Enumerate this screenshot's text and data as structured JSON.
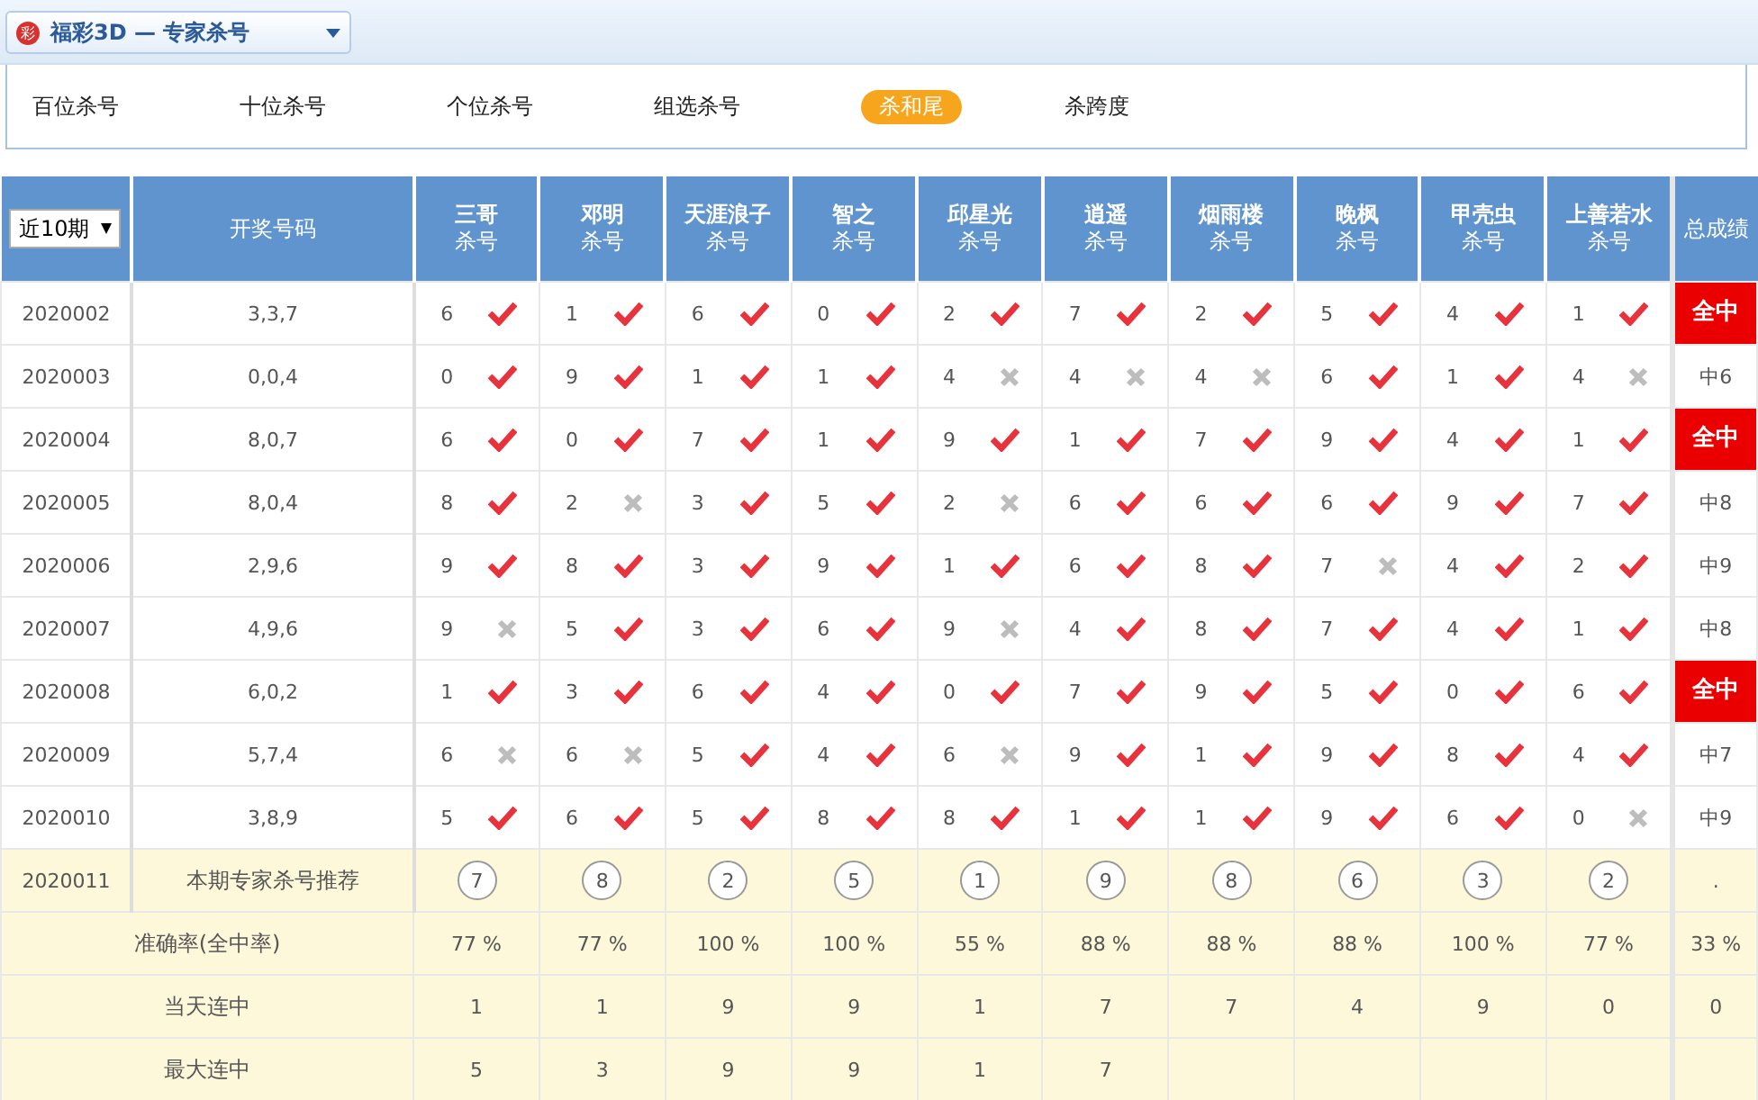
{
  "header": {
    "logo": "彩",
    "product": "福彩3D",
    "separator": "—",
    "title": "专家杀号"
  },
  "tabs": [
    {
      "label": "百位杀号",
      "selected": false
    },
    {
      "label": "十位杀号",
      "selected": false
    },
    {
      "label": "个位杀号",
      "selected": false
    },
    {
      "label": "组选杀号",
      "selected": false
    },
    {
      "label": "杀和尾",
      "selected": true
    },
    {
      "label": "杀跨度",
      "selected": false
    }
  ],
  "table": {
    "period_select": "近10期",
    "draw_heading": "开奖号码",
    "total_heading": "总成绩",
    "experts": [
      {
        "name": "三哥",
        "sub": "杀号"
      },
      {
        "name": "邓明",
        "sub": "杀号"
      },
      {
        "name": "天涯浪子",
        "sub": "杀号"
      },
      {
        "name": "智之",
        "sub": "杀号"
      },
      {
        "name": "邱星光",
        "sub": "杀号"
      },
      {
        "name": "逍遥",
        "sub": "杀号"
      },
      {
        "name": "烟雨楼",
        "sub": "杀号"
      },
      {
        "name": "晚枫",
        "sub": "杀号"
      },
      {
        "name": "甲壳虫",
        "sub": "杀号"
      },
      {
        "name": "上善若水",
        "sub": "杀号"
      }
    ],
    "rows": [
      {
        "period": "2020002",
        "draw": "3,3,7",
        "picks": [
          [
            "6",
            true
          ],
          [
            "1",
            true
          ],
          [
            "6",
            true
          ],
          [
            "0",
            true
          ],
          [
            "2",
            true
          ],
          [
            "7",
            true
          ],
          [
            "2",
            true
          ],
          [
            "5",
            true
          ],
          [
            "4",
            true
          ],
          [
            "1",
            true
          ]
        ],
        "result": "全中",
        "full_hit": true
      },
      {
        "period": "2020003",
        "draw": "0,0,4",
        "picks": [
          [
            "0",
            true
          ],
          [
            "9",
            true
          ],
          [
            "1",
            true
          ],
          [
            "1",
            true
          ],
          [
            "4",
            false
          ],
          [
            "4",
            false
          ],
          [
            "4",
            false
          ],
          [
            "6",
            true
          ],
          [
            "1",
            true
          ],
          [
            "4",
            false
          ]
        ],
        "result": "中6",
        "full_hit": false
      },
      {
        "period": "2020004",
        "draw": "8,0,7",
        "picks": [
          [
            "6",
            true
          ],
          [
            "0",
            true
          ],
          [
            "7",
            true
          ],
          [
            "1",
            true
          ],
          [
            "9",
            true
          ],
          [
            "1",
            true
          ],
          [
            "7",
            true
          ],
          [
            "9",
            true
          ],
          [
            "4",
            true
          ],
          [
            "1",
            true
          ]
        ],
        "result": "全中",
        "full_hit": true
      },
      {
        "period": "2020005",
        "draw": "8,0,4",
        "picks": [
          [
            "8",
            true
          ],
          [
            "2",
            false
          ],
          [
            "3",
            true
          ],
          [
            "5",
            true
          ],
          [
            "2",
            false
          ],
          [
            "6",
            true
          ],
          [
            "6",
            true
          ],
          [
            "6",
            true
          ],
          [
            "9",
            true
          ],
          [
            "7",
            true
          ]
        ],
        "result": "中8",
        "full_hit": false
      },
      {
        "period": "2020006",
        "draw": "2,9,6",
        "picks": [
          [
            "9",
            true
          ],
          [
            "8",
            true
          ],
          [
            "3",
            true
          ],
          [
            "9",
            true
          ],
          [
            "1",
            true
          ],
          [
            "6",
            true
          ],
          [
            "8",
            true
          ],
          [
            "7",
            false
          ],
          [
            "4",
            true
          ],
          [
            "2",
            true
          ]
        ],
        "result": "中9",
        "full_hit": false
      },
      {
        "period": "2020007",
        "draw": "4,9,6",
        "picks": [
          [
            "9",
            false
          ],
          [
            "5",
            true
          ],
          [
            "3",
            true
          ],
          [
            "6",
            true
          ],
          [
            "9",
            false
          ],
          [
            "4",
            true
          ],
          [
            "8",
            true
          ],
          [
            "7",
            true
          ],
          [
            "4",
            true
          ],
          [
            "1",
            true
          ]
        ],
        "result": "中8",
        "full_hit": false
      },
      {
        "period": "2020008",
        "draw": "6,0,2",
        "picks": [
          [
            "1",
            true
          ],
          [
            "3",
            true
          ],
          [
            "6",
            true
          ],
          [
            "4",
            true
          ],
          [
            "0",
            true
          ],
          [
            "7",
            true
          ],
          [
            "9",
            true
          ],
          [
            "5",
            true
          ],
          [
            "0",
            true
          ],
          [
            "6",
            true
          ]
        ],
        "result": "全中",
        "full_hit": true
      },
      {
        "period": "2020009",
        "draw": "5,7,4",
        "picks": [
          [
            "6",
            false
          ],
          [
            "6",
            false
          ],
          [
            "5",
            true
          ],
          [
            "4",
            true
          ],
          [
            "6",
            false
          ],
          [
            "9",
            true
          ],
          [
            "1",
            true
          ],
          [
            "9",
            true
          ],
          [
            "8",
            true
          ],
          [
            "4",
            true
          ]
        ],
        "result": "中7",
        "full_hit": false
      },
      {
        "period": "2020010",
        "draw": "3,8,9",
        "picks": [
          [
            "5",
            true
          ],
          [
            "6",
            true
          ],
          [
            "5",
            true
          ],
          [
            "8",
            true
          ],
          [
            "8",
            true
          ],
          [
            "1",
            true
          ],
          [
            "1",
            true
          ],
          [
            "9",
            true
          ],
          [
            "6",
            true
          ],
          [
            "0",
            false
          ]
        ],
        "result": "中9",
        "full_hit": false
      }
    ],
    "recommend": {
      "period": "2020011",
      "label": "本期专家杀号推荐",
      "numbers": [
        "7",
        "8",
        "2",
        "5",
        "1",
        "9",
        "8",
        "6",
        "3",
        "2"
      ],
      "total": "."
    },
    "stats": [
      {
        "label": "准确率(全中率)",
        "values": [
          "77 %",
          "77 %",
          "100 %",
          "100 %",
          "55 %",
          "88 %",
          "88 %",
          "88 %",
          "100 %",
          "77 %"
        ],
        "total": "33 %"
      },
      {
        "label": "当天连中",
        "values": [
          "1",
          "1",
          "9",
          "9",
          "1",
          "7",
          "7",
          "4",
          "9",
          "0"
        ],
        "total": "0"
      },
      {
        "label": "最大连中",
        "values": [
          "5",
          "3",
          "9",
          "9",
          "1",
          "7"
        ]
      }
    ]
  }
}
